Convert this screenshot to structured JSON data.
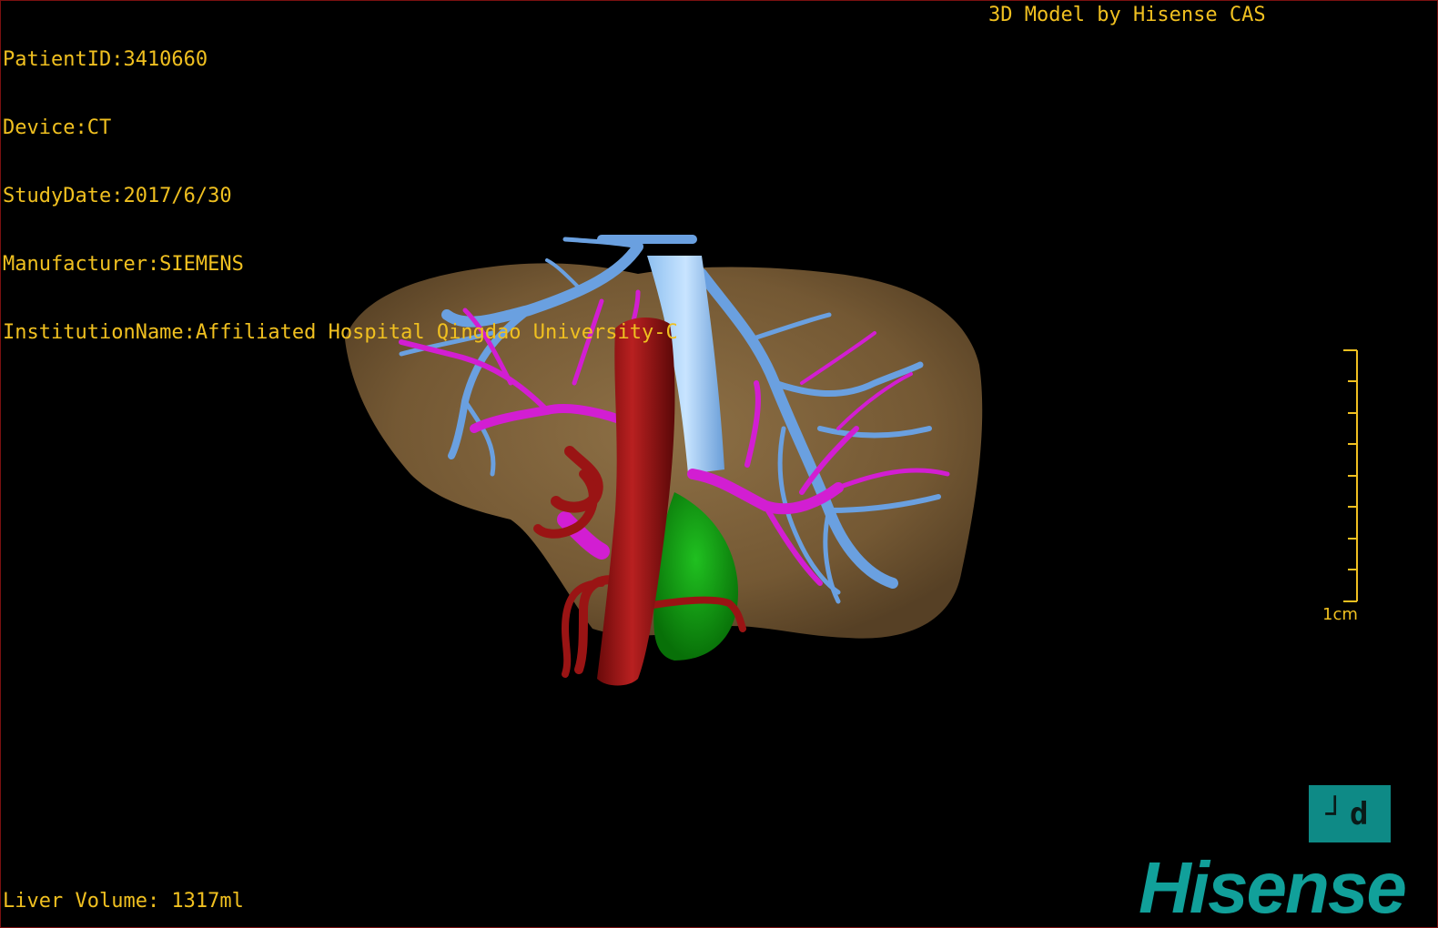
{
  "overlay": {
    "patient_id": "PatientID:3410660",
    "device": "Device:CT",
    "study_date": "StudyDate:2017/6/30",
    "manufacturer": "Manufacturer:SIEMENS",
    "institution": "InstitutionName:Affiliated Hospital Qingdao University-C",
    "model_credit": "3D Model by Hisense CAS",
    "liver_volume": "Liver Volume: 1317ml"
  },
  "scale_bar": {
    "label": "1cm"
  },
  "orientation_cube": {
    "label": "┘d"
  },
  "logo": {
    "text": "Hisense"
  },
  "colors": {
    "overlay_text": "#f0c020",
    "liver": "#8a6a40",
    "hepatic_vein": "#6aa0e0",
    "portal_vein": "#d21ed2",
    "artery": "#9a1414",
    "gallbladder": "#10a010",
    "brand": "#11a09a"
  }
}
